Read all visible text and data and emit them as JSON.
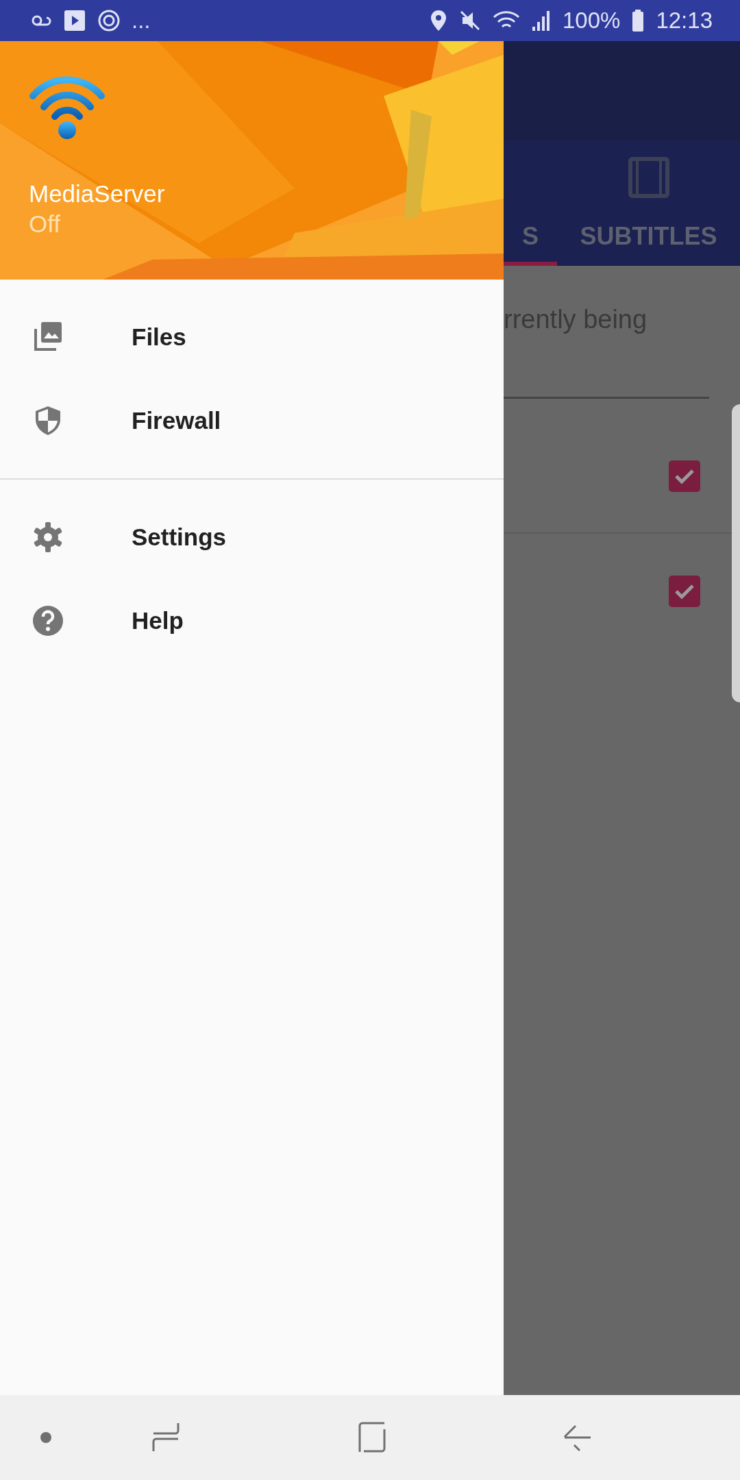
{
  "status_bar": {
    "overflow": "...",
    "battery": "100%",
    "time": "12:13"
  },
  "drawer": {
    "header": {
      "title": "MediaServer",
      "subtitle": "Off"
    },
    "sections": [
      {
        "items": [
          {
            "label": "Files",
            "kind": "files"
          },
          {
            "label": "Firewall",
            "kind": "firewall"
          }
        ]
      },
      {
        "items": [
          {
            "label": "Settings",
            "kind": "settings"
          },
          {
            "label": "Help",
            "kind": "help"
          }
        ]
      }
    ]
  },
  "behind": {
    "tabs": [
      {
        "label": "S",
        "selected": true
      },
      {
        "label": "SUBTITLES",
        "selected": false,
        "kind": "subtitles"
      }
    ],
    "text": "rrently being",
    "rows": [
      {
        "checked": true
      },
      {
        "checked": true
      }
    ]
  }
}
